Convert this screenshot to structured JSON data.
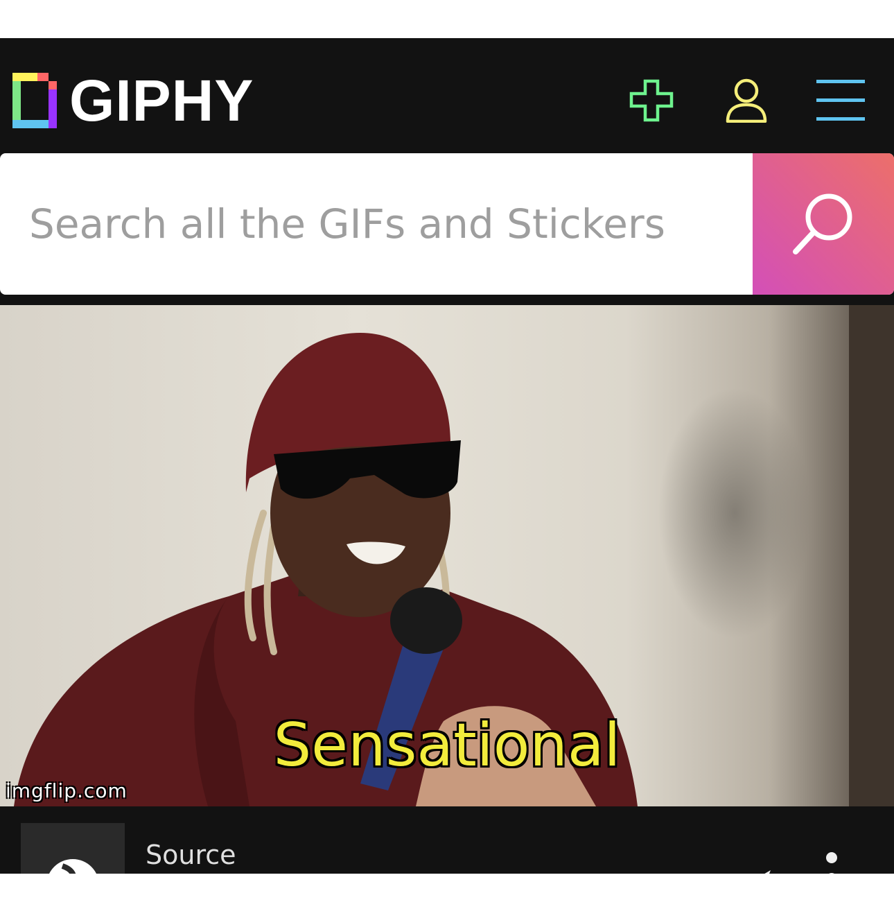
{
  "header": {
    "logo_text": "GIPHY",
    "icons": [
      "upload-plus-icon",
      "user-icon",
      "hamburger-menu-icon"
    ],
    "colors": {
      "background": "#121212",
      "plus": "#6ef38e",
      "user": "#f5ee7a",
      "menu": "#5fc4f0"
    }
  },
  "search": {
    "placeholder": "Search all the GIFs and Stickers",
    "value": "",
    "button_icon": "search-icon",
    "button_gradient": [
      "#d34fb8",
      "#ec6f6a"
    ]
  },
  "gif": {
    "caption": "Sensational",
    "watermark": "imgflip.com"
  },
  "footer": {
    "source_label": "Source",
    "icons": [
      "share-icon",
      "more-options-icon"
    ]
  }
}
